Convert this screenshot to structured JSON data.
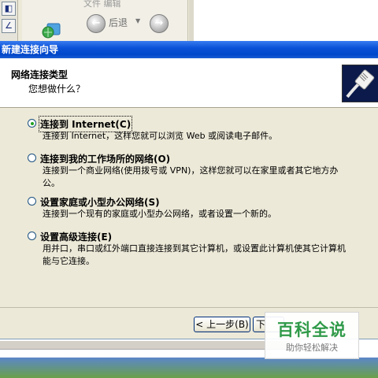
{
  "background": {
    "toolbar_faded_text": "文件   编辑",
    "back_button_label": "后退",
    "forward_icon": "arrow-right-icon",
    "back_icon": "arrow-left-icon"
  },
  "window": {
    "title": "新建连接向导"
  },
  "header": {
    "title": "网络连接类型",
    "subtitle": "您想做什么？",
    "icon": "network-cable-icon"
  },
  "options": [
    {
      "label": "连接到 Internet(C)",
      "description": "连接到 Internet，这样您就可以浏览 Web 或阅读电子邮件。",
      "selected": true
    },
    {
      "label": "连接到我的工作场所的网络(O)",
      "description": "连接到一个商业网络(使用拨号或 VPN)，这样您就可以在家里或者其它地方办公。",
      "selected": false
    },
    {
      "label": "设置家庭或小型办公网络(S)",
      "description": "连接到一个现有的家庭或小型办公网络，或者设置一个新的。",
      "selected": false
    },
    {
      "label": "设置高级连接(E)",
      "description": "用并口，串口或红外端口直接连接到其它计算机，或设置此计算机使其它计算机能与它连接。",
      "selected": false
    }
  ],
  "footer": {
    "back_label": "< 上一步(B)",
    "next_label": "下"
  },
  "watermark": {
    "brand": "百科全说",
    "tagline": "助你轻松解决"
  },
  "colors": {
    "titlebar": "#0a52d8",
    "dialog_bg": "#ece9d8",
    "radio_dot": "#21a121",
    "watermark_green": "#2f9a49"
  }
}
